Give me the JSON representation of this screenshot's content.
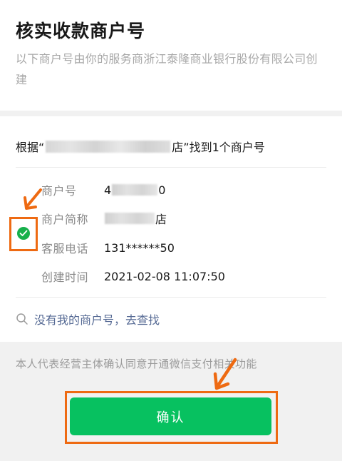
{
  "header": {
    "title": "核实收款商户号",
    "subtitle": "以下商户号由你的服务商浙江泰隆商业银行股份有限公司创建"
  },
  "merchant": {
    "found_prefix": "根据“",
    "found_suffix": "店”找到1个商户号",
    "fields": [
      {
        "label": "商户号",
        "value_prefix": "4",
        "value_suffix": "0"
      },
      {
        "label": "商户简称",
        "value_prefix": "",
        "value_suffix": "店"
      },
      {
        "label": "客服电话",
        "value": "131******50"
      },
      {
        "label": "创建时间",
        "value": "2021-02-08 11:07:50"
      }
    ],
    "selected": true
  },
  "search_link": {
    "label": "没有我的商户号，去查找",
    "icon": "search-icon"
  },
  "footer": {
    "agreement_text": "本人代表经营主体确认同意开通微信支付相关功能",
    "confirm_label": "确认"
  },
  "colors": {
    "accent_green": "#07c160",
    "check_green": "#17b04b",
    "link_blue": "#576b95",
    "annotation_orange": "#ee6a12"
  }
}
